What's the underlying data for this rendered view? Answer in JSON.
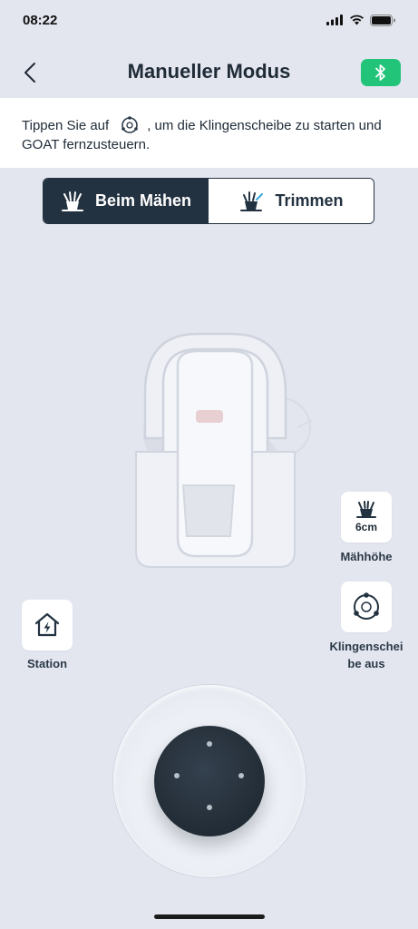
{
  "status_bar": {
    "time": "08:22"
  },
  "header": {
    "title": "Manueller Modus"
  },
  "info": {
    "text_before": "Tippen Sie auf",
    "text_after": ", um die Klingenscheibe zu starten und",
    "line2": "GOAT fernzusteuern."
  },
  "segments": [
    {
      "label": "Beim Mähen",
      "active": true
    },
    {
      "label": "Trimmen",
      "active": false
    }
  ],
  "controls": {
    "station": {
      "label": "Station"
    },
    "cutting_height": {
      "value": "6cm",
      "label": "Mähhöhe"
    },
    "blade": {
      "label_line1": "Klingenschei",
      "label_line2": "be aus"
    }
  },
  "colors": {
    "background": "#e3e6ef",
    "dark": "#233241",
    "accent_bluetooth": "#22c47a",
    "white": "#ffffff"
  },
  "icons": [
    "back-chevron-icon",
    "bluetooth-icon",
    "blade-disc-icon",
    "grass-mowing-icon",
    "grass-trimming-icon",
    "station-home-icon",
    "cutting-height-icon",
    "wifi-icon",
    "battery-icon",
    "signal-icon"
  ]
}
